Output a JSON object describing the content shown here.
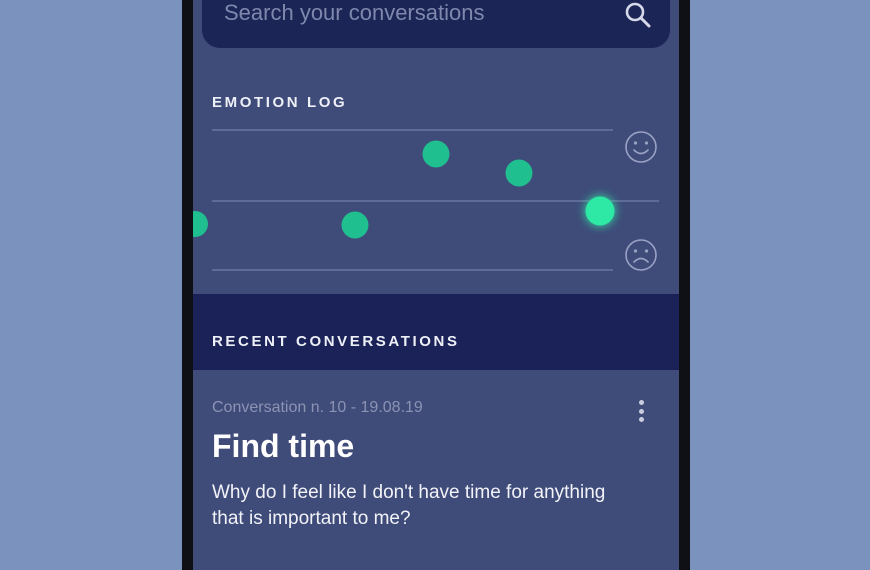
{
  "search": {
    "placeholder": "Search your conversations",
    "icon": "search-icon"
  },
  "emotion_log": {
    "title": "EMOTION LOG",
    "icons": {
      "happy": "smiley-face-icon",
      "sad": "sad-face-icon"
    },
    "colors": {
      "point": "#1fbf8f",
      "point_highlight": "#2ee8a6",
      "line": "#6a75a0"
    }
  },
  "recent": {
    "title": "RECENT CONVERSATIONS"
  },
  "conversation": {
    "meta": "Conversation n. 10 - 19.08.19",
    "title": "Find time",
    "body": "Why do I feel like I don't have time for anything that is important to me?",
    "menu_icon": "more-vertical-icon"
  }
}
